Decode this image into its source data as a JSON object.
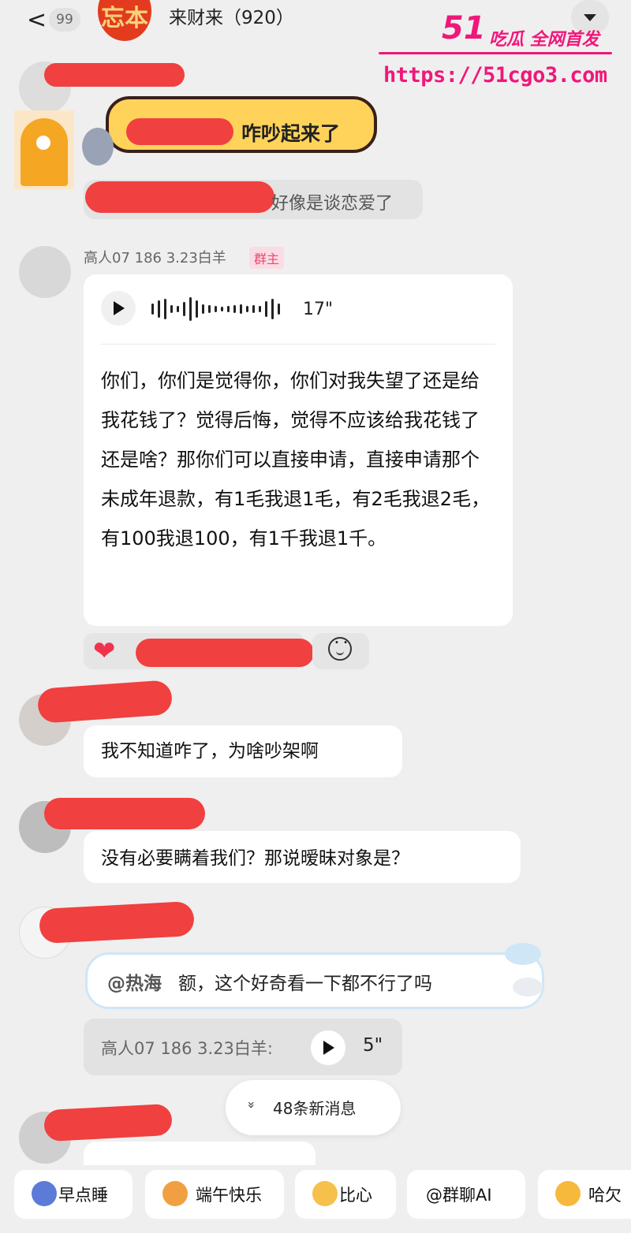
{
  "header": {
    "back_glyph": "<",
    "unread_count": "99",
    "group_avatar_text": "忘本",
    "group_title": "来财来（920）",
    "menu_icon": "triangle-down-icon"
  },
  "watermark": {
    "brand_number": "51",
    "brand_text": "吃瓜 全网首发",
    "url": "https://51cgo3.com"
  },
  "messages": {
    "banner_text": "咋吵起来了",
    "reply_snippet": "好像是谈恋爱了",
    "owner": {
      "sender_name": "高人07  186  3.23白羊",
      "role_tag": "群主",
      "voice_duration": "17\"",
      "transcript": "你们，你们是觉得你，你们对我失望了还是给我花钱了？觉得后悔，觉得不应该给我花钱了还是啥？那你们可以直接申请，直接申请那个未成年退款，有1毛我退1毛，有2毛我退2毛，有100我退100，有1千我退1千。"
    },
    "msg1": "我不知道咋了，为啥吵架啊",
    "msg2": "没有必要瞒着我们？那说暧昧对象是？",
    "quote": {
      "mention": "@热海",
      "text": "额，这个好奇看一下都不行了吗"
    },
    "reply_ref": {
      "name": "高人07  186  3.23白羊:",
      "duration": "5\""
    }
  },
  "new_messages_pill": {
    "chevron": "»",
    "label": "48条新消息"
  },
  "quick_chips": [
    {
      "label": "早点睡",
      "icon": "moon-sleep-icon"
    },
    {
      "label": "端午快乐",
      "icon": "dragon-icon"
    },
    {
      "label": "比心",
      "icon": "heart-hands-icon"
    },
    {
      "label": "@群聊AI",
      "icon": "ai-icon"
    },
    {
      "label": "哈欠",
      "icon": "yawn-icon"
    }
  ],
  "colors": {
    "watermark_pink": "#f0177a",
    "redaction_red": "#f0403f",
    "owner_tag_pink": "#e64a6f",
    "heart_red": "#f0334b",
    "background": "#efefef"
  }
}
